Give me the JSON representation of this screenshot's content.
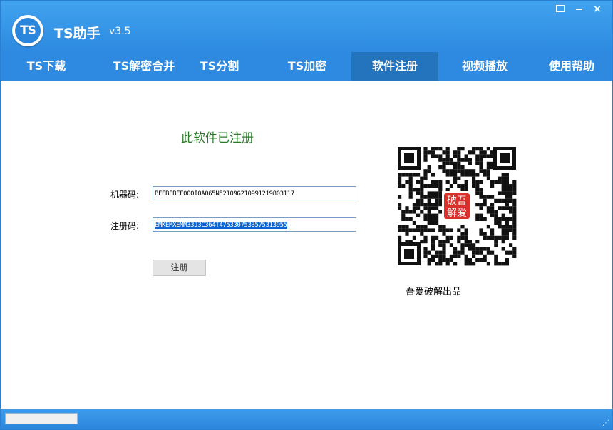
{
  "app": {
    "logo_text": "TS",
    "title": "TS助手",
    "version": "v3.5"
  },
  "window_controls": {
    "menu": "menu-icon",
    "minimize": "minimize-icon",
    "close": "×"
  },
  "tabs": [
    {
      "label": "TS下载",
      "active": false
    },
    {
      "label": "TS解密合并",
      "active": false
    },
    {
      "label": "TS分割",
      "active": false
    },
    {
      "label": "TS加密",
      "active": false
    },
    {
      "label": "软件注册",
      "active": true
    },
    {
      "label": "视频播放",
      "active": false
    },
    {
      "label": "使用帮助",
      "active": false
    }
  ],
  "registration": {
    "status": "此软件已注册",
    "machine_code_label": "机器码:",
    "machine_code": "BFEBFBFF000I0A065N52109G210991219803117",
    "reg_code_label": "注册码:",
    "reg_code": "EMKEMXEMM33J3C364T4753307533575313955",
    "register_button": "注册"
  },
  "qr": {
    "stamp_line1": "破吾",
    "stamp_line2": "解爱",
    "caption": "吾爱破解出品"
  },
  "status_bar": {
    "progress": 0
  },
  "colors": {
    "title_bar": "#3b9be9",
    "nav_bar": "#2d8ae0",
    "active_tab": "#2473bd",
    "status_text": "#2c7a2c",
    "selection": "#0a64d2",
    "stamp": "#d9302c"
  }
}
